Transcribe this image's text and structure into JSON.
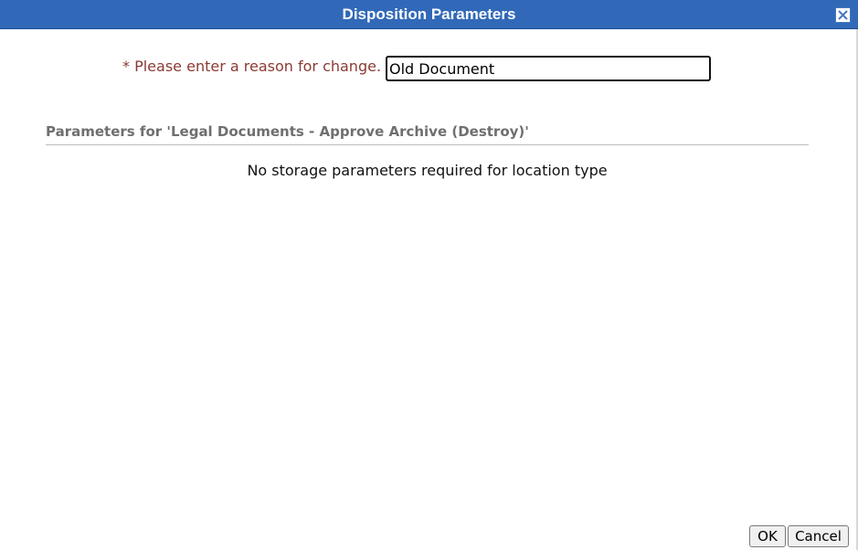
{
  "dialog": {
    "title": "Disposition Parameters",
    "close_icon": "close-x-icon"
  },
  "reason": {
    "label": "* Please enter a reason for change.",
    "value": "Old Document"
  },
  "parameters": {
    "header": "Parameters for 'Legal Documents - Approve Archive (Destroy)'",
    "message": "No storage parameters required for location type"
  },
  "buttons": {
    "ok_label": "OK",
    "cancel_label": "Cancel"
  },
  "colors": {
    "titlebar": "#3169b8",
    "label_required": "#8b3a35",
    "section_header": "#6f6f6f"
  }
}
